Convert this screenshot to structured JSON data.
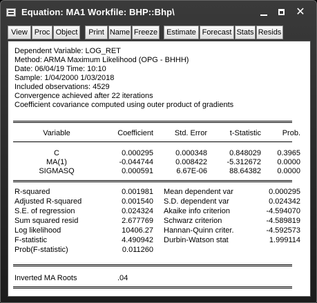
{
  "window": {
    "title": "Equation: MA1   Workfile: BHP::Bhp\\"
  },
  "toolbar": [
    "View",
    "Proc",
    "Object",
    "Print",
    "Name",
    "Freeze",
    "Estimate",
    "Forecast",
    "Stats",
    "Resids"
  ],
  "header_lines": [
    "Dependent Variable: LOG_RET",
    "Method: ARMA Maximum Likelihood (OPG - BHHH)",
    "Date: 06/04/19   Time: 10:10",
    "Sample: 1/04/2000 1/03/2018",
    "Included observations: 4529",
    "Convergence achieved after 22 iterations",
    "Coefficient covariance computed using outer product of gradients"
  ],
  "coef_table": {
    "headers": [
      "Variable",
      "Coefficient",
      "Std. Error",
      "t-Statistic",
      "Prob."
    ],
    "rows": [
      [
        "C",
        "0.000295",
        "0.000348",
        "0.848029",
        "0.3965"
      ],
      [
        "MA(1)",
        "-0.044744",
        "0.008422",
        "-5.312672",
        "0.0000"
      ],
      [
        "SIGMASQ",
        "0.000591",
        "6.67E-06",
        "88.64382",
        "0.0000"
      ]
    ]
  },
  "stats": {
    "left": [
      [
        "R-squared",
        "0.001981"
      ],
      [
        "Adjusted R-squared",
        "0.001540"
      ],
      [
        "S.E. of regression",
        "0.024324"
      ],
      [
        "Sum squared resid",
        "2.677769"
      ],
      [
        "Log likelihood",
        "10406.27"
      ],
      [
        "F-statistic",
        "4.490942"
      ],
      [
        "Prob(F-statistic)",
        "0.011260"
      ]
    ],
    "right": [
      [
        "Mean dependent var",
        "0.000295"
      ],
      [
        "S.D. dependent var",
        "0.024342"
      ],
      [
        "Akaike info criterion",
        "-4.594070"
      ],
      [
        "Schwarz criterion",
        "-4.589819"
      ],
      [
        "Hannan-Quinn criter.",
        "-4.592573"
      ],
      [
        "Durbin-Watson stat",
        "1.999114"
      ]
    ]
  },
  "roots": {
    "label": "Inverted MA Roots",
    "value": ".04"
  },
  "icons": {
    "app": "equation-window-icon",
    "minimize": "minimize-icon",
    "maximize": "maximize-icon",
    "close": "close-icon"
  }
}
